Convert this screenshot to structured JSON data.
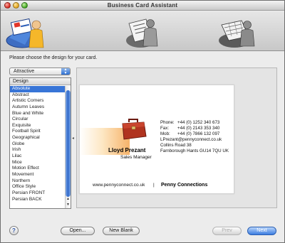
{
  "window": {
    "title": "Business Card Assistant"
  },
  "toolbar": {
    "items": [
      {
        "icon": "card-design-icon"
      },
      {
        "icon": "card-details-icon"
      },
      {
        "icon": "card-print-icon"
      }
    ]
  },
  "instruction": "Please choose the design for your card.",
  "filter_popup": {
    "selected": "Attractive"
  },
  "design_list": {
    "header": "Design",
    "selected": "Absolute",
    "items": [
      "Absolute",
      "Abstract",
      "Artistic Corners",
      "Autumn Leaves",
      "Blue and White",
      "Circular",
      "Exquisite",
      "Football Spirit",
      "Geographical",
      "Globe",
      "Irish",
      "Lilac",
      "Mice",
      "Motion Effect",
      "Movement",
      "Northern",
      "Office Style",
      "Persian  FRONT",
      "Persian BACK"
    ]
  },
  "card": {
    "name": "Lloyd Prezant",
    "role": "Sales Manager",
    "phone_label": "Phone:",
    "phone": "+44 (0) 1252 340 673",
    "fax_label": "Fax:",
    "fax": "+44 (0) 2143 353 340",
    "mob_label": "Mob:",
    "mob": "+44 (0) 7866 132 097",
    "email": "LPrezant@pennyconnect.co.uk",
    "address1": "Collins Road 38",
    "address2": "Farnborough Hants GU14 7QU UK",
    "website": "www.pennyconnect.co.uk",
    "separator": "|",
    "company": "Penny Connections"
  },
  "buttons": {
    "help": "?",
    "open": "Open...",
    "new_blank": "New Blank",
    "prev": "Prev",
    "next": "Next"
  },
  "colors": {
    "selection": "#3875d7",
    "next_button": "#3b7de0",
    "card_accent": "#f6b36a",
    "briefcase": "#b0331f"
  }
}
